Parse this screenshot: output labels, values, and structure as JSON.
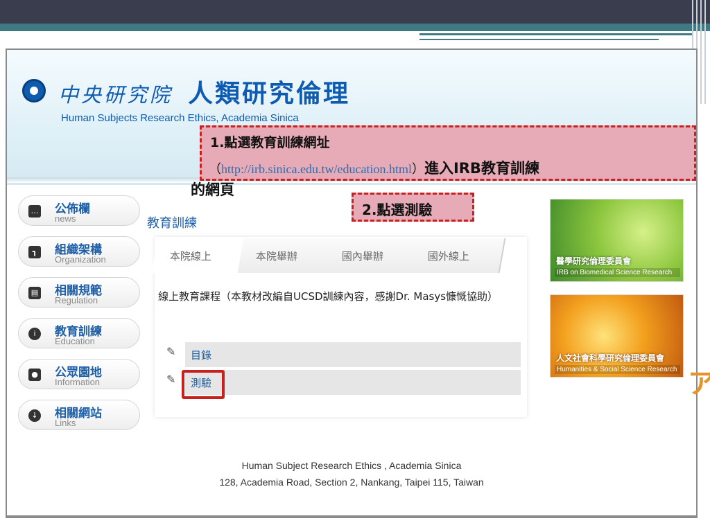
{
  "header": {
    "academia_logo_text": "中央研究院",
    "title": "人類研究倫理",
    "subtitle": "Human Subjects Research Ethics, Academia Sinica"
  },
  "callouts": {
    "step1_title": "1.點選教育訓練網址",
    "step1_url": "http://irb.sinica.edu.tw/education.html",
    "step1_paren_open": "（",
    "step1_paren_close": "）",
    "step1_text": "進入IRB教育訓練",
    "step1_text_cont": "的網頁",
    "step2_label": "2.點選測驗",
    "color": "#c8201f"
  },
  "sidebar": {
    "items": [
      {
        "label": "公佈欄",
        "sub": "news",
        "icon": "chat-icon"
      },
      {
        "label": "組織架構",
        "sub": "Organization",
        "icon": "org-chart-icon"
      },
      {
        "label": "相關規範",
        "sub": "Regulation",
        "icon": "document-icon"
      },
      {
        "label": "教育訓練",
        "sub": "Education",
        "icon": "info-icon"
      },
      {
        "label": "公眾園地",
        "sub": "Information",
        "icon": "person-icon"
      },
      {
        "label": "相關網站",
        "sub": "Links",
        "icon": "arrow-down-circle-icon"
      }
    ]
  },
  "main": {
    "section_title": "教育訓練",
    "tabs": [
      "本院線上",
      "本院舉辦",
      "國內舉辦",
      "國外線上"
    ],
    "active_tab": 0,
    "course_description": "線上教育課程（本教材改編自UCSD訓練內容，感謝Dr. Masys慷慨協助）",
    "resources": [
      "目錄",
      "測驗"
    ]
  },
  "banners": [
    {
      "title": "醫學研究倫理委員會",
      "subtitle": "IRB on Biomedical Science Research"
    },
    {
      "title": "人文社會科學研究倫理委員會",
      "subtitle": "Humanities & Social Science Research"
    }
  ],
  "footer": {
    "line1": "Human Subject Research Ethics , Academia Sinica",
    "line2": "128, Academia Road, Section 2, Nankang, Taipei 115, Taiwan"
  },
  "colors": {
    "brand_blue": "#0e5bb0",
    "link_blue": "#1d5fa8",
    "callout_fill": "#e6abb7"
  }
}
